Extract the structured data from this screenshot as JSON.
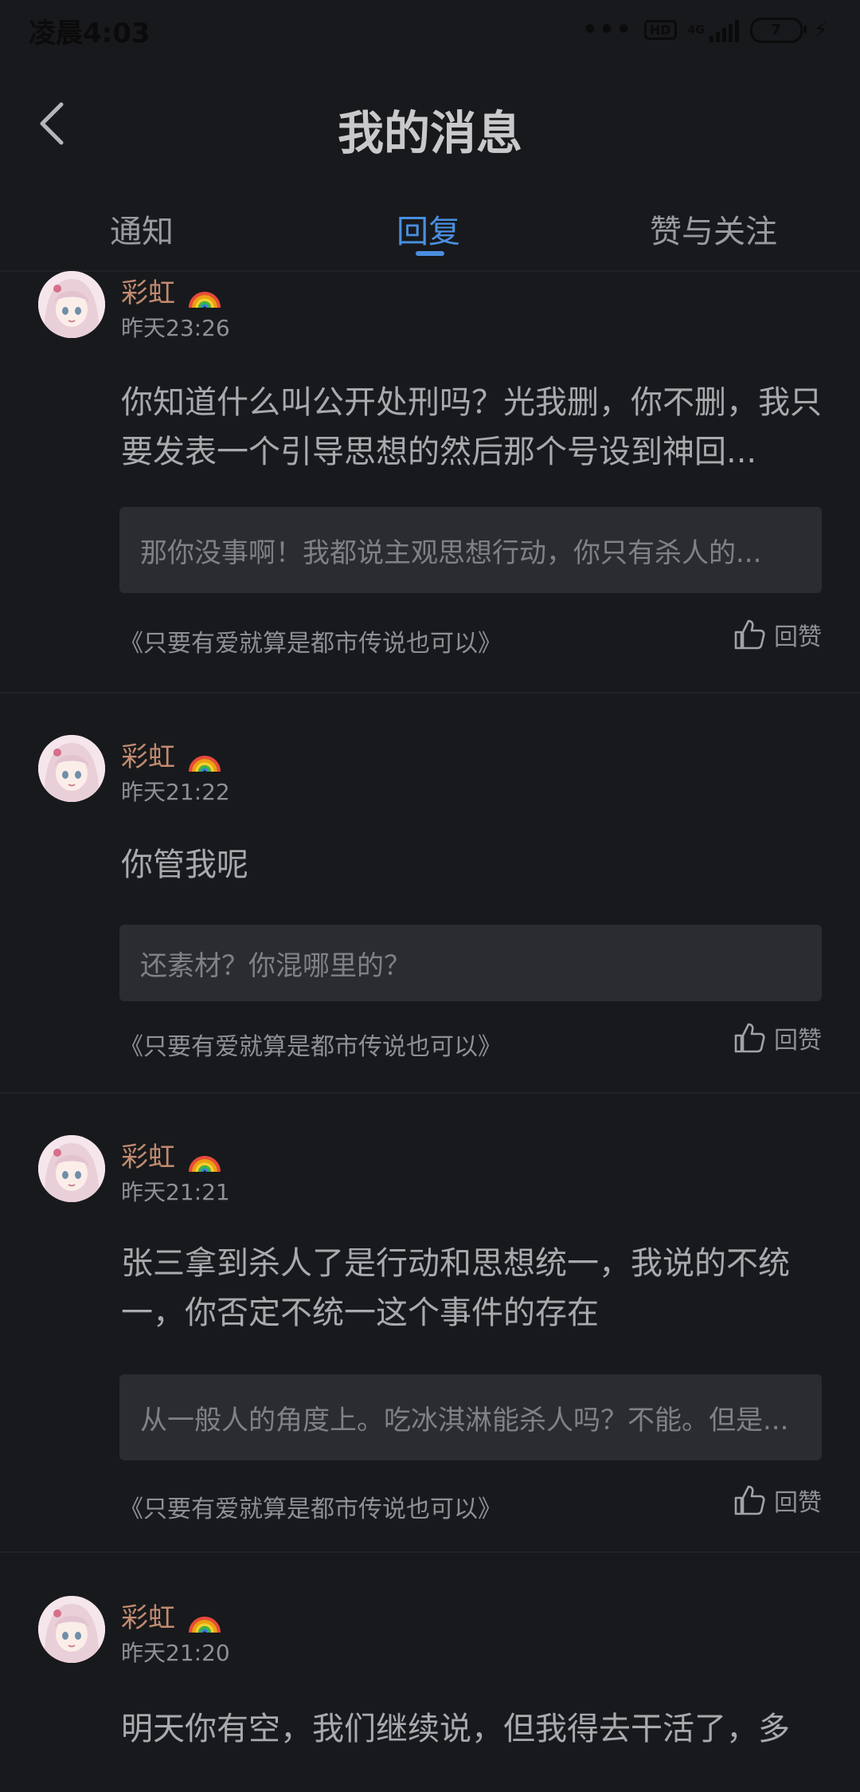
{
  "status_bar": {
    "time": "凌晨4:03",
    "dots": "•••",
    "hd": "HD",
    "network": "4G",
    "battery": "7"
  },
  "header": {
    "title": "我的消息"
  },
  "tabs": [
    {
      "label": "通知",
      "active": false
    },
    {
      "label": "回复",
      "active": true
    },
    {
      "label": "赞与关注",
      "active": false
    }
  ],
  "messages": [
    {
      "username": "彩虹",
      "time": "昨天23:26",
      "content": "你知道什么叫公开处刑吗？光我删，你不删，我只要发表一个引导思想的然后那个号设到神回...",
      "quote": "那你没事啊！我都说主观思想行动，你只有杀人的...",
      "source": "《只要有爱就算是都市传说也可以》",
      "like_label": "回赞"
    },
    {
      "username": "彩虹",
      "time": "昨天21:22",
      "content": "你管我呢",
      "quote": "还素材？你混哪里的？",
      "source": "《只要有爱就算是都市传说也可以》",
      "like_label": "回赞"
    },
    {
      "username": "彩虹",
      "time": "昨天21:21",
      "content": "张三拿到杀人了是行动和思想统一，我说的不统一，你否定不统一这个事件的存在",
      "quote": "从一般人的角度上。吃冰淇淋能杀人吗？不能。但是...",
      "source": "《只要有爱就算是都市传说也可以》",
      "like_label": "回赞"
    },
    {
      "username": "彩虹",
      "time": "昨天21:20",
      "content": "明天你有空，我们继续说，但我得去干活了，多"
    }
  ],
  "colors": {
    "background": "#18191c",
    "accent": "#4a8fe0",
    "username": "#c18a6f",
    "quote_bg": "#2b2c30"
  }
}
